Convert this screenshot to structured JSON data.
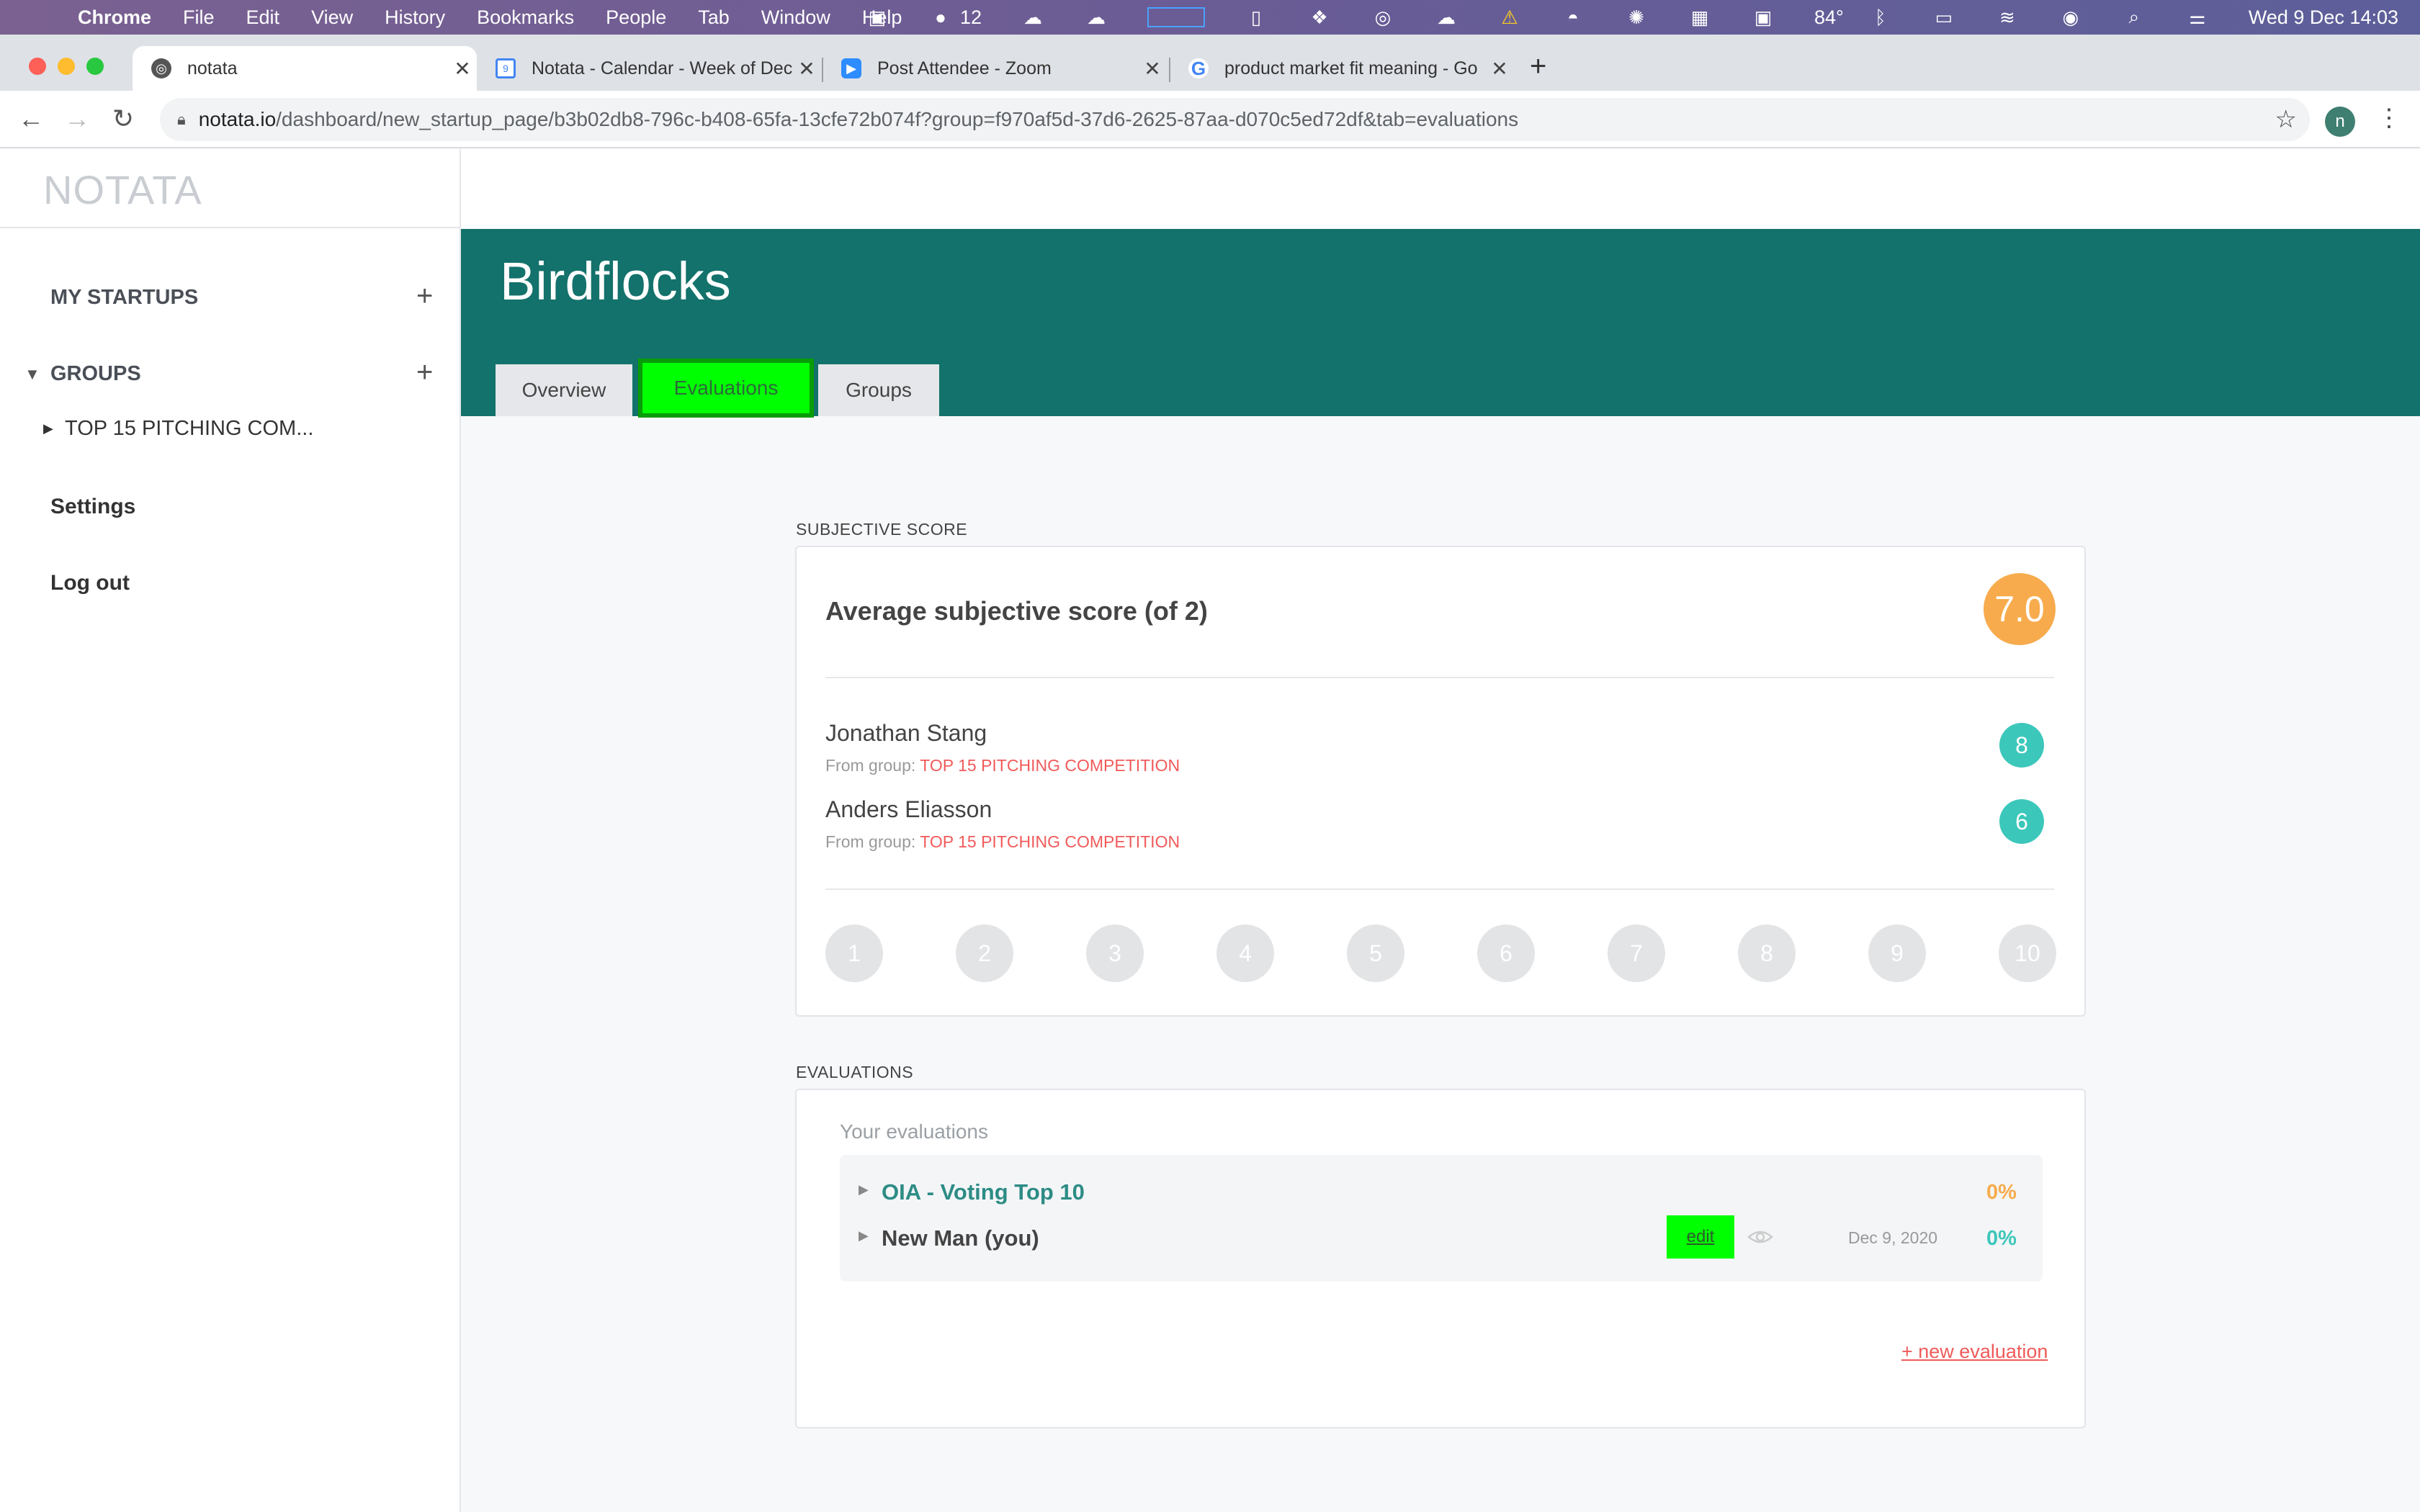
{
  "menubar": {
    "app": "Chrome",
    "items": [
      "File",
      "Edit",
      "View",
      "History",
      "Bookmarks",
      "People",
      "Tab",
      "Window",
      "Help"
    ],
    "badge_count": "12",
    "temperature": "84°",
    "clock": "Wed 9 Dec  14:03"
  },
  "browser": {
    "tabs": [
      {
        "title": "notata"
      },
      {
        "title": "Notata - Calendar - Week of Dec"
      },
      {
        "title": "Post Attendee - Zoom"
      },
      {
        "title": "product market fit meaning - Go"
      }
    ],
    "url_host": "notata.io",
    "url_path": "/dashboard/new_startup_page/b3b02db8-796c-b408-65fa-13cfe72b074f?group=f970af5d-37d6-2625-87aa-d070c5ed72df&tab=evaluations",
    "profile_initial": "n"
  },
  "sidebar": {
    "logo": "NOTATA",
    "my_startups": "MY STARTUPS",
    "groups": "GROUPS",
    "group_item": "TOP 15 PITCHING COM...",
    "settings": "Settings",
    "logout": "Log out"
  },
  "header": {
    "startup_name": "Birdflocks",
    "tabs": [
      "Overview",
      "Evaluations",
      "Groups"
    ]
  },
  "subjective": {
    "section_title": "SUBJECTIVE SCORE",
    "avg_label": "Average subjective score (of 2)",
    "avg_score": "7.0",
    "group_prefix": "From group: ",
    "evaluators": [
      {
        "name": "Jonathan Stang",
        "group": "TOP 15 PITCHING COMPETITION",
        "score": "8"
      },
      {
        "name": "Anders Eliasson",
        "group": "TOP 15 PITCHING COMPETITION",
        "score": "6"
      }
    ],
    "scale": [
      "1",
      "2",
      "3",
      "4",
      "5",
      "6",
      "7",
      "8",
      "9",
      "10"
    ]
  },
  "evaluations": {
    "section_title": "EVALUATIONS",
    "your_label": "Your evaluations",
    "rows": [
      {
        "title": "OIA - Voting Top 10",
        "pct": "0%"
      },
      {
        "title": "New Man (you)",
        "pct": "0%",
        "edit": "edit",
        "date": "Dec 9, 2020"
      }
    ],
    "new_link": "+ new evaluation"
  },
  "colors": {
    "header_bg": "#13726b",
    "accent_orange": "#f7ab4c",
    "accent_teal": "#3cc7bb",
    "accent_red": "#f15a5a",
    "highlight_green": "#00ff00"
  }
}
